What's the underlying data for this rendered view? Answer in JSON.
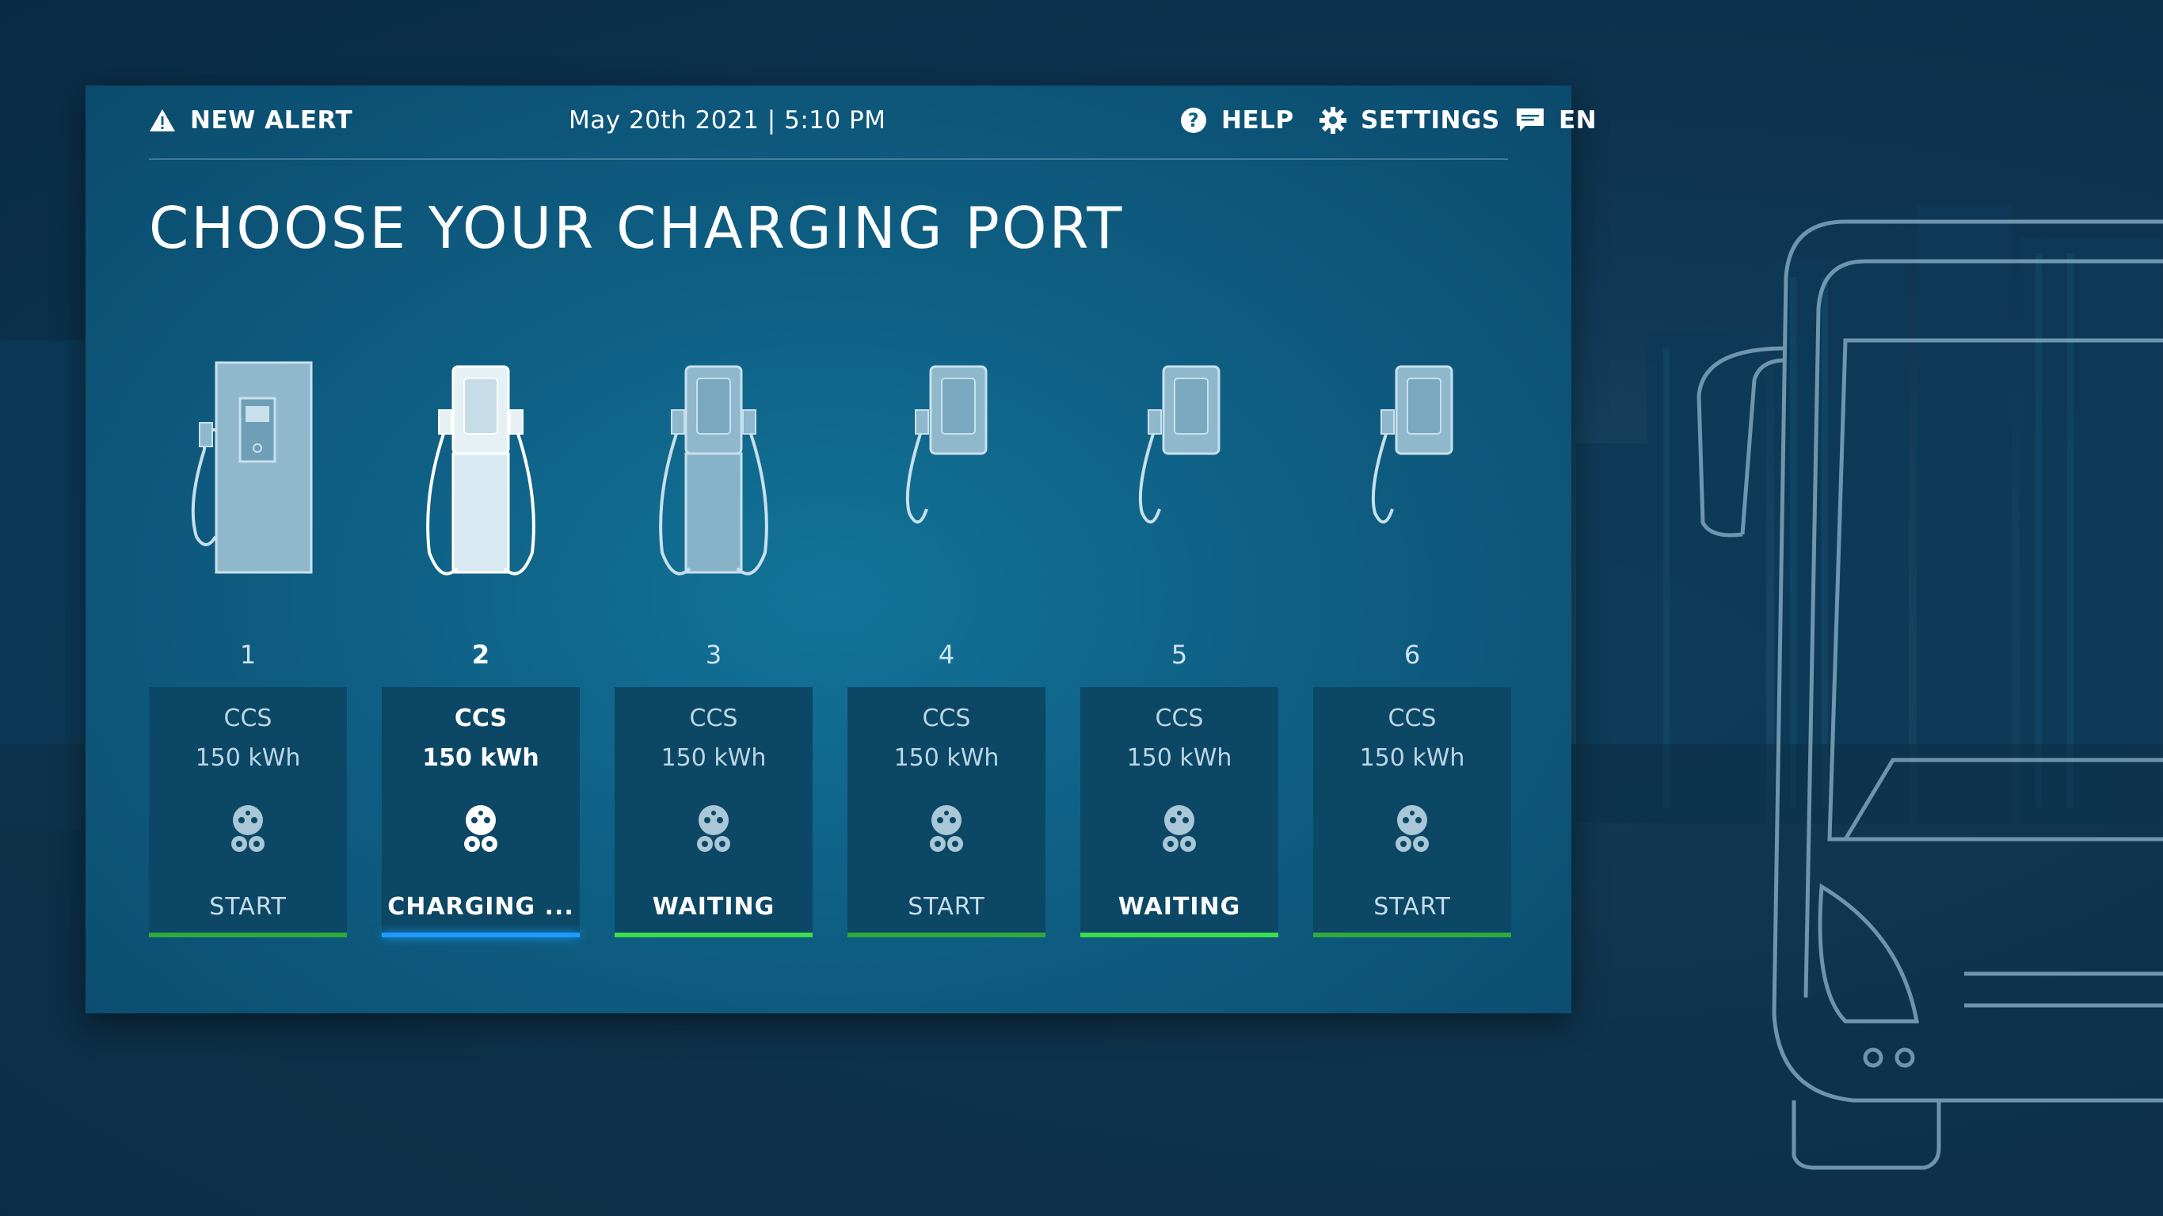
{
  "header": {
    "alert_label": "NEW ALERT",
    "datetime": "May 20th 2021 | 5:10 PM",
    "help_label": "HELP",
    "settings_label": "SETTINGS",
    "language_label": "EN"
  },
  "title": "CHOOSE YOUR CHARGING PORT",
  "ports": [
    {
      "number": "1",
      "type": "CCS",
      "power": "150 kWh",
      "status": "START",
      "state": "start"
    },
    {
      "number": "2",
      "type": "CCS",
      "power": "150 kWh",
      "status": "CHARGING ...",
      "state": "charging"
    },
    {
      "number": "3",
      "type": "CCS",
      "power": "150 kWh",
      "status": "WAITING",
      "state": "waiting"
    },
    {
      "number": "4",
      "type": "CCS",
      "power": "150 kWh",
      "status": "START",
      "state": "start"
    },
    {
      "number": "5",
      "type": "CCS",
      "power": "150 kWh",
      "status": "WAITING",
      "state": "waiting"
    },
    {
      "number": "6",
      "type": "CCS",
      "power": "150 kWh",
      "status": "START",
      "state": "start"
    }
  ],
  "colors": {
    "start_bar": "#2faa3c",
    "waiting_bar": "#3ddc4a",
    "charging_bar": "#1e9bff"
  }
}
